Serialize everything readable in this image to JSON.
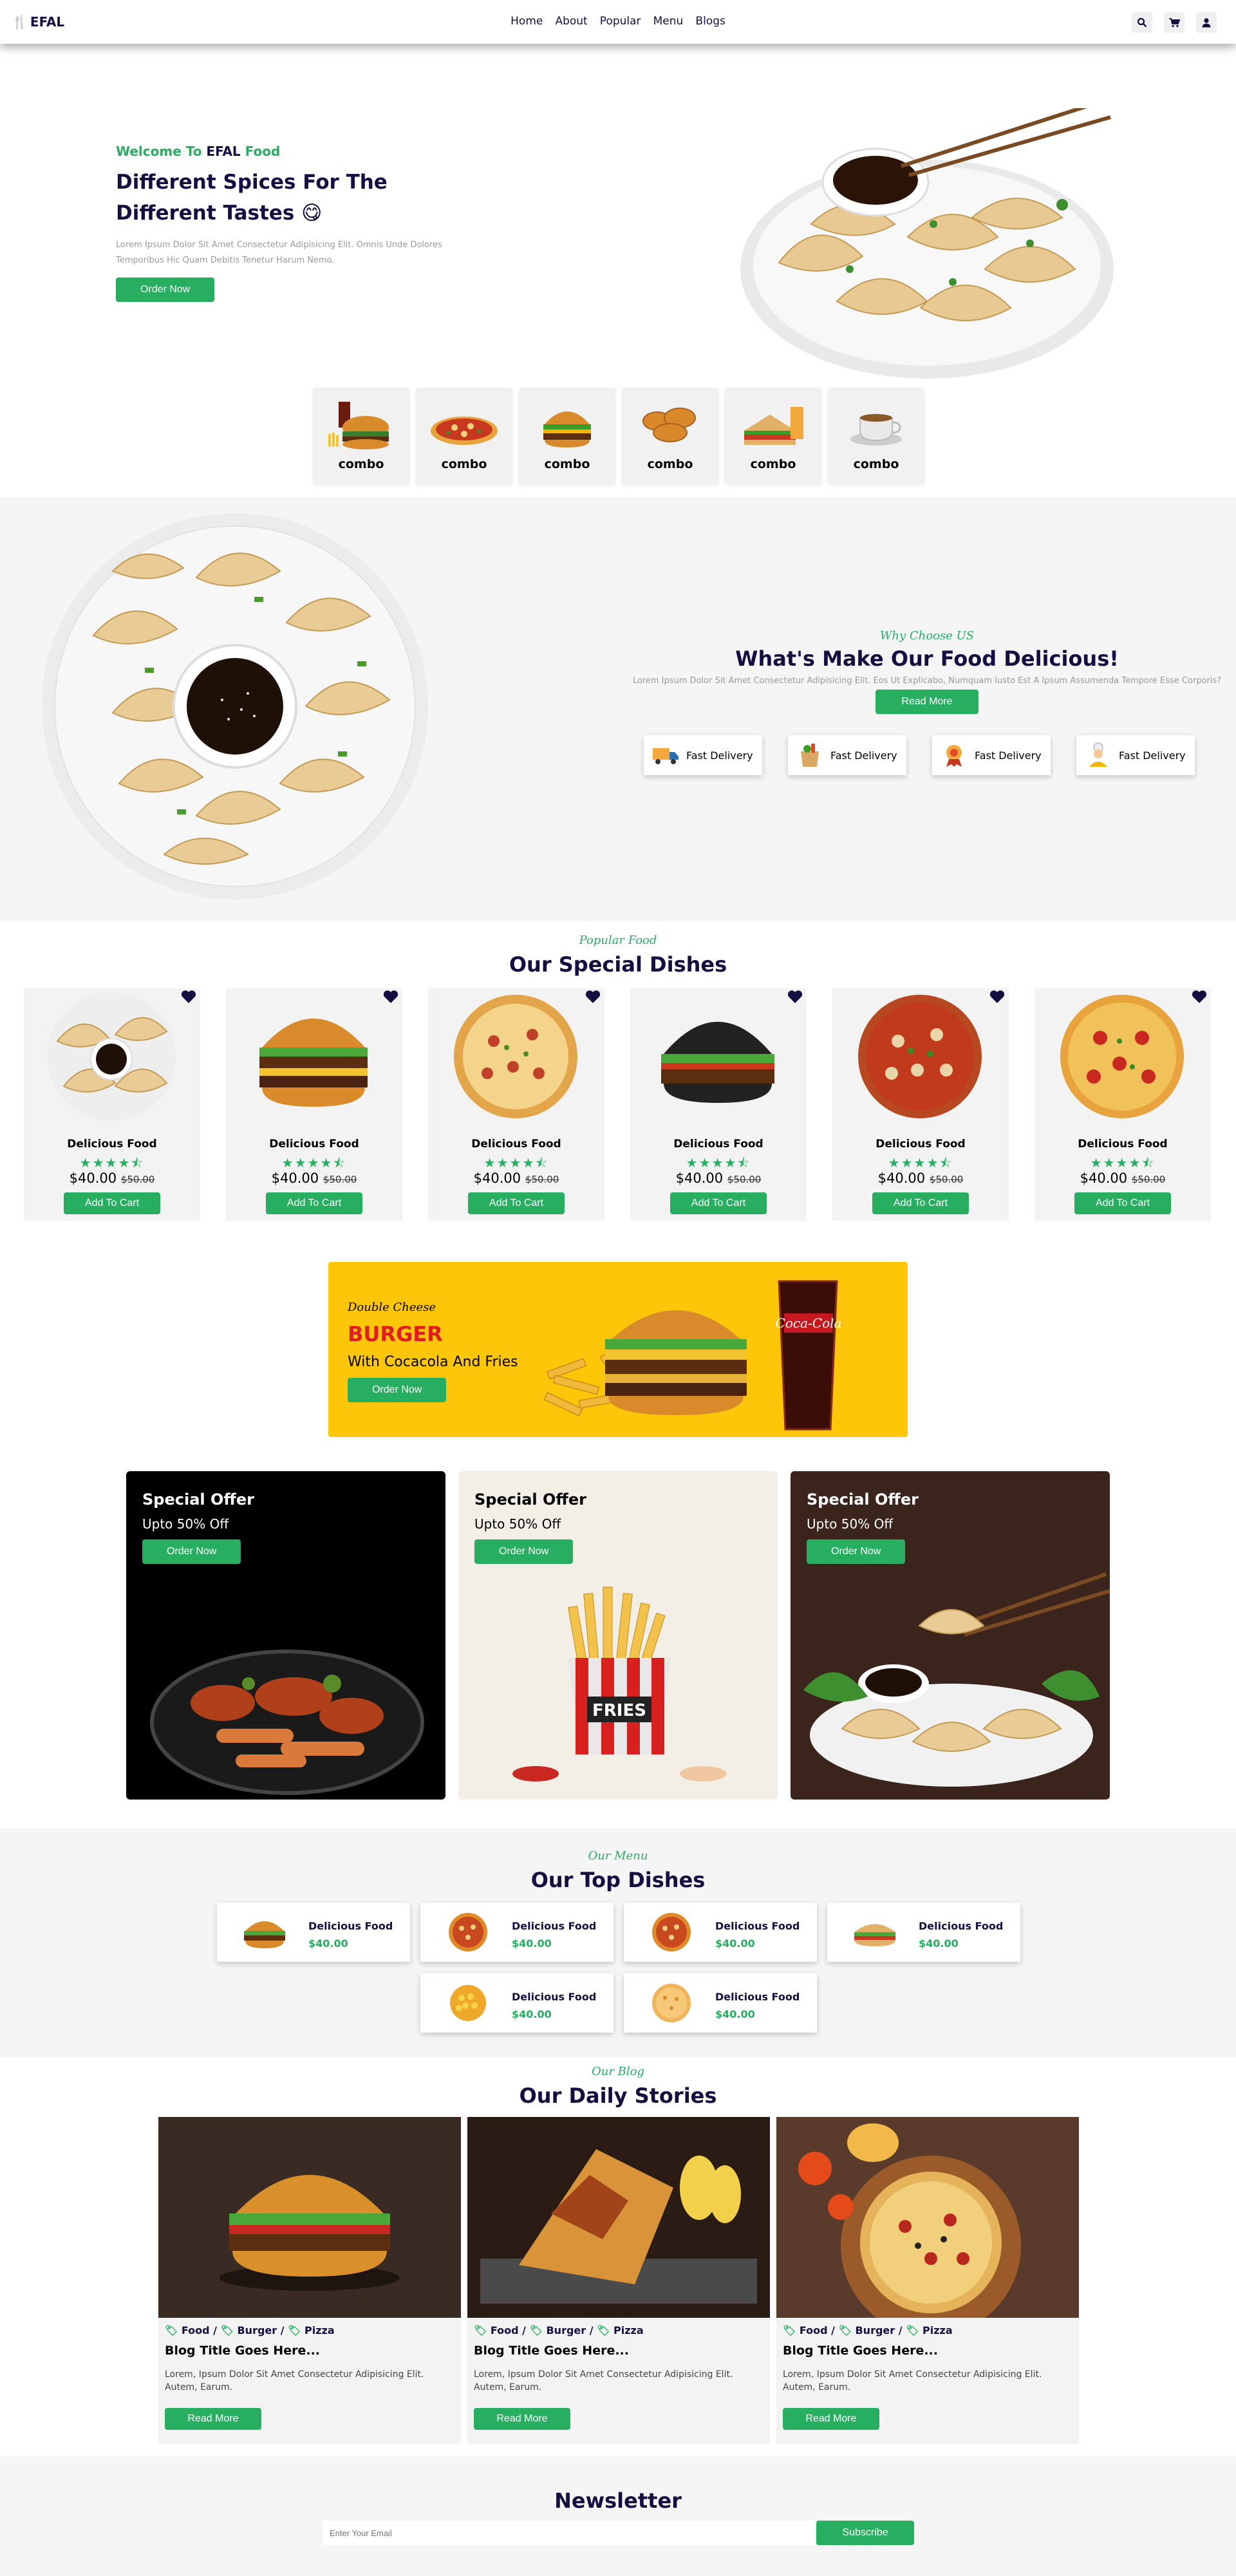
{
  "header": {
    "logo": "EFAL",
    "nav": [
      "Home",
      "About",
      "Popular",
      "Menu",
      "Blogs"
    ]
  },
  "hero": {
    "subtitle_prefix": "Welcome To ",
    "subtitle_brand": "EFAL",
    "subtitle_suffix": " Food",
    "title": "Different Spices For The Different Tastes 😋",
    "description": "Lorem Ipsum Dolor Sit Amet Consectetur Adipisicing Elit. Omnis Unde Dolores Temporibus Hic Quam Debitis Tenetur Harum Nemo.",
    "button": "Order Now"
  },
  "combos": [
    {
      "label": "combo",
      "icon": "burger-combo-icon"
    },
    {
      "label": "combo",
      "icon": "pizza-combo-icon"
    },
    {
      "label": "combo",
      "icon": "burger-icon"
    },
    {
      "label": "combo",
      "icon": "fried-chicken-icon"
    },
    {
      "label": "combo",
      "icon": "sandwich-combo-icon"
    },
    {
      "label": "combo",
      "icon": "coffee-icon"
    }
  ],
  "why": {
    "script": "Why Choose US",
    "title": "What's Make Our Food Delicious!",
    "description": "Lorem Ipsum Dolor Sit Amet Consectetur Adipisicing Elit. Eos Ut Explicabo, Numquam Iusto Est A Ipsum Assumenda Tempore Esse Corporis?",
    "button": "Read More",
    "features": [
      {
        "label": "Fast Delivery",
        "icon": "truck-icon"
      },
      {
        "label": "Fast Delivery",
        "icon": "grocery-bag-icon"
      },
      {
        "label": "Fast Delivery",
        "icon": "award-icon"
      },
      {
        "label": "Fast Delivery",
        "icon": "chef-icon"
      }
    ]
  },
  "popular": {
    "script": "Popular Food",
    "title": "Our Special Dishes",
    "dishes": [
      {
        "name": "Delicious Food",
        "rating": 4.5,
        "price": "$40.00",
        "old_price": "$50.00",
        "button": "Add To Cart",
        "pic": "dumplings"
      },
      {
        "name": "Delicious Food",
        "rating": 4.5,
        "price": "$40.00",
        "old_price": "$50.00",
        "button": "Add To Cart",
        "pic": "burger"
      },
      {
        "name": "Delicious Food",
        "rating": 4.5,
        "price": "$40.00",
        "old_price": "$50.00",
        "button": "Add To Cart",
        "pic": "pizza"
      },
      {
        "name": "Delicious Food",
        "rating": 4.5,
        "price": "$40.00",
        "old_price": "$50.00",
        "button": "Add To Cart",
        "pic": "black-burger"
      },
      {
        "name": "Delicious Food",
        "rating": 4.5,
        "price": "$40.00",
        "old_price": "$50.00",
        "button": "Add To Cart",
        "pic": "pizza-mushroom"
      },
      {
        "name": "Delicious Food",
        "rating": 4.5,
        "price": "$40.00",
        "old_price": "$50.00",
        "button": "Add To Cart",
        "pic": "pizza-pepperoni"
      }
    ]
  },
  "banner": {
    "small": "Double Cheese",
    "big": "BURGER",
    "with": "With Cocacola And Fries",
    "button": "Order Now"
  },
  "offers": [
    {
      "title": "Special Offer",
      "sub": "Upto 50% Off",
      "button": "Order Now",
      "theme": "dark",
      "pic": "grill"
    },
    {
      "title": "Special Offer",
      "sub": "Upto 50% Off",
      "button": "Order Now",
      "theme": "light",
      "pic": "fries"
    },
    {
      "title": "Special Offer",
      "sub": "Upto 50% Off",
      "button": "Order Now",
      "theme": "brown",
      "pic": "dumplings"
    }
  ],
  "menu": {
    "script": "Our Menu",
    "title": "Our Top Dishes",
    "items": [
      {
        "name": "Delicious Food",
        "price": "$40.00",
        "pic": "burger-icon"
      },
      {
        "name": "Delicious Food",
        "price": "$40.00",
        "pic": "pizza-icon"
      },
      {
        "name": "Delicious Food",
        "price": "$40.00",
        "pic": "pizza-icon"
      },
      {
        "name": "Delicious Food",
        "price": "$40.00",
        "pic": "sandwich-icon"
      },
      {
        "name": "Delicious Food",
        "price": "$40.00",
        "pic": "corn-icon"
      },
      {
        "name": "Delicious Food",
        "price": "$40.00",
        "pic": "cookie-icon"
      }
    ]
  },
  "blog": {
    "script": "Our Blog",
    "title": "Our Daily Stories",
    "posts": [
      {
        "tags": [
          "Food",
          "Burger",
          "Pizza"
        ],
        "title": "Blog Title Goes Here...",
        "desc": "Lorem, Ipsum Dolor Sit Amet Consectetur Adipisicing Elit. Autem, Earum.",
        "button": "Read More",
        "pic": "burger"
      },
      {
        "tags": [
          "Food",
          "Burger",
          "Pizza"
        ],
        "title": "Blog Title Goes Here...",
        "desc": "Lorem, Ipsum Dolor Sit Amet Consectetur Adipisicing Elit. Autem, Earum.",
        "button": "Read More",
        "pic": "wrap"
      },
      {
        "tags": [
          "Food",
          "Burger",
          "Pizza"
        ],
        "title": "Blog Title Goes Here...",
        "desc": "Lorem, Ipsum Dolor Sit Amet Consectetur Adipisicing Elit. Autem, Earum.",
        "button": "Read More",
        "pic": "pizza"
      }
    ]
  },
  "newsletter": {
    "title": "Newsletter",
    "placeholder": "Enter Your Email",
    "button": "Subscribe"
  },
  "colors": {
    "accent": "#27ae60",
    "dark": "#130f40",
    "banner": "#fec609",
    "burger_red": "#e31b23"
  }
}
